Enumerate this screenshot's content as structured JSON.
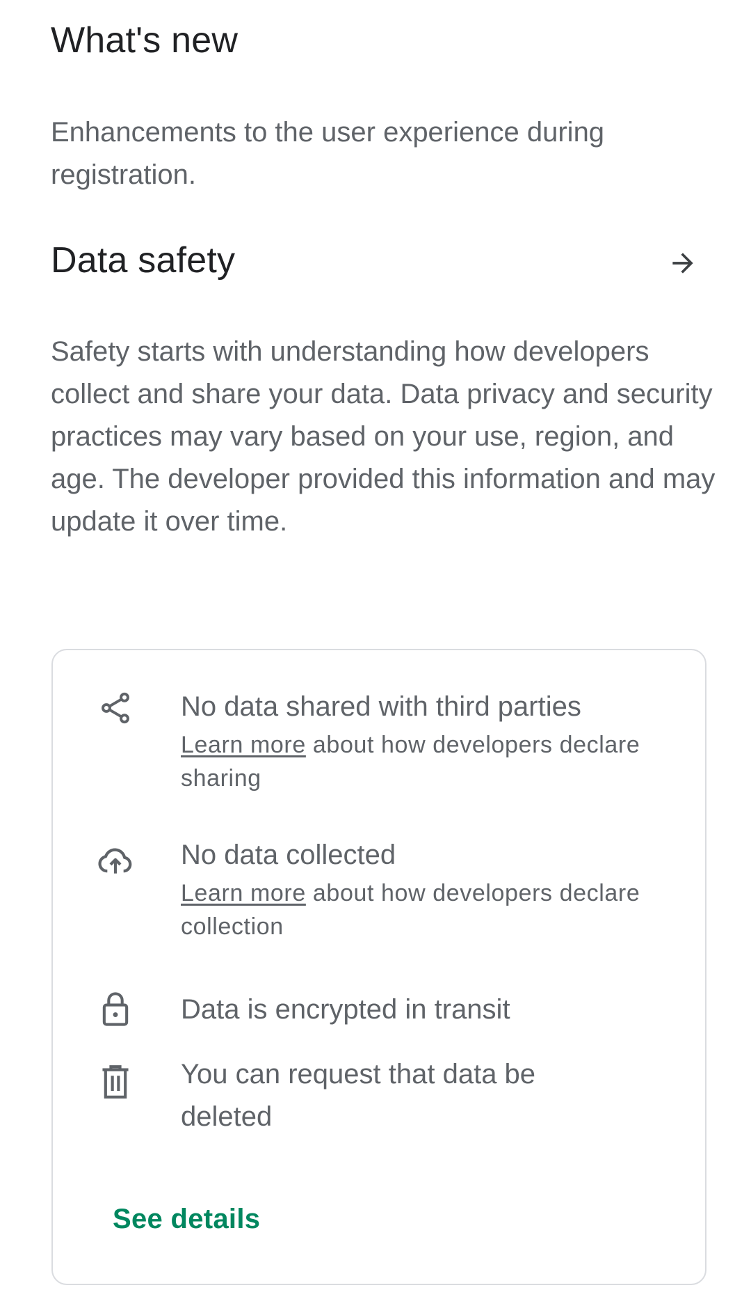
{
  "whats_new": {
    "title": "What's new",
    "text": "Enhancements to the user experience during registration."
  },
  "data_safety": {
    "title": "Data safety",
    "arrow_icon": "arrow-right-icon",
    "description": "Safety starts with understanding how developers collect and share your data. Data privacy and security practices may vary based on your use, region, and age. The developer provided this information and may update it over time.",
    "items": [
      {
        "icon": "share-icon",
        "title": "No data shared with third parties",
        "link": "Learn more",
        "sub": " about how developers declare sharing"
      },
      {
        "icon": "cloud-upload-icon",
        "title": "No data collected",
        "link": "Learn more",
        "sub": " about how developers declare collection"
      },
      {
        "icon": "lock-icon",
        "title": "Data is encrypted in transit"
      },
      {
        "icon": "trash-icon",
        "title": "You can request that data be deleted"
      }
    ],
    "see_details": "See details"
  },
  "colors": {
    "accent": "#01875f",
    "text_primary": "#202124",
    "text_secondary": "#5f6368",
    "border": "#dadce0"
  }
}
